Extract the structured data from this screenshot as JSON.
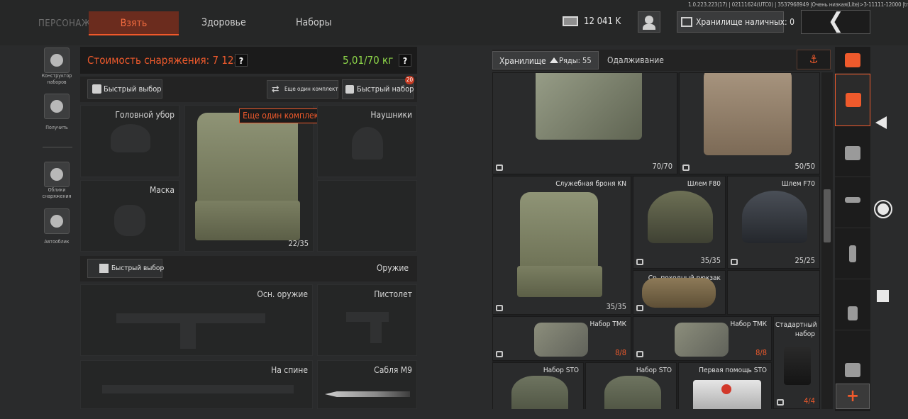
{
  "top": {
    "version": "1.0.223.223(17) | 02111624(UTC0) | 3537968949 |Очень низкая(Lite)>3-11111-12000 |tn",
    "tab_character": "ПЕРСОНАЖ",
    "tab_take": "Взять",
    "tab_health": "Здоровье",
    "tab_kits": "Наборы",
    "money": "12 041 K",
    "cash_storage": "Хранилище наличных: 0"
  },
  "left_menu": [
    {
      "label": "Конструктор наборов",
      "icon": "kit-builder-icon"
    },
    {
      "label": "Получить",
      "icon": "receive-icon"
    },
    {
      "label": "Облики снаряжения",
      "icon": "gear-skins-icon"
    },
    {
      "label": "Автооблик",
      "icon": "auto-skin-icon"
    }
  ],
  "loadout": {
    "cost_label": "Стоимость снаряжения: 7 123",
    "weight": "5,01/70 кг",
    "quick_select": "Быстрый выбор",
    "another_kit": "Еще один комплект",
    "quick_kit": "Быстрый набор",
    "quick_kit_badge": "20",
    "tooltip": "Еще один комплект.",
    "slots": {
      "headwear": "Головной убор",
      "mask": "Маска",
      "headphones": "Наушники",
      "armor_count": "22/35"
    },
    "weapons_quick_select": "Быстрый выбор",
    "weapons_title": "Оружие",
    "primary": "Осн. оружие",
    "pistol": "Пистолет",
    "back": "На спине",
    "melee": "Сабля М9"
  },
  "storage": {
    "tab": "Хранилище",
    "rows": "Ряды: 55",
    "remove_tab": "Одалживание",
    "items": [
      {
        "label": "",
        "count": "70/70"
      },
      {
        "label": "",
        "count": "50/50"
      },
      {
        "label": "Служебная броня KN",
        "count": "35/35"
      },
      {
        "label": "Шлем F80",
        "count": "35/35"
      },
      {
        "label": "Шлем F70",
        "count": "25/25"
      },
      {
        "label": "Ср. походный рюкзак",
        "count": ""
      },
      {
        "label": "Набор ТМК",
        "count": "8/8"
      },
      {
        "label": "Набор ТМК",
        "count": "8/8"
      },
      {
        "label": "Стадартный набор",
        "count": "4/4"
      },
      {
        "label": "Набор STO",
        "count": ""
      },
      {
        "label": "Набор STO",
        "count": ""
      },
      {
        "label": "Первая помощь STO",
        "count": ""
      }
    ]
  },
  "colors": {
    "accent": "#ef5a2c",
    "weight": "#8fd84a",
    "panel": "#1f1f1f"
  }
}
